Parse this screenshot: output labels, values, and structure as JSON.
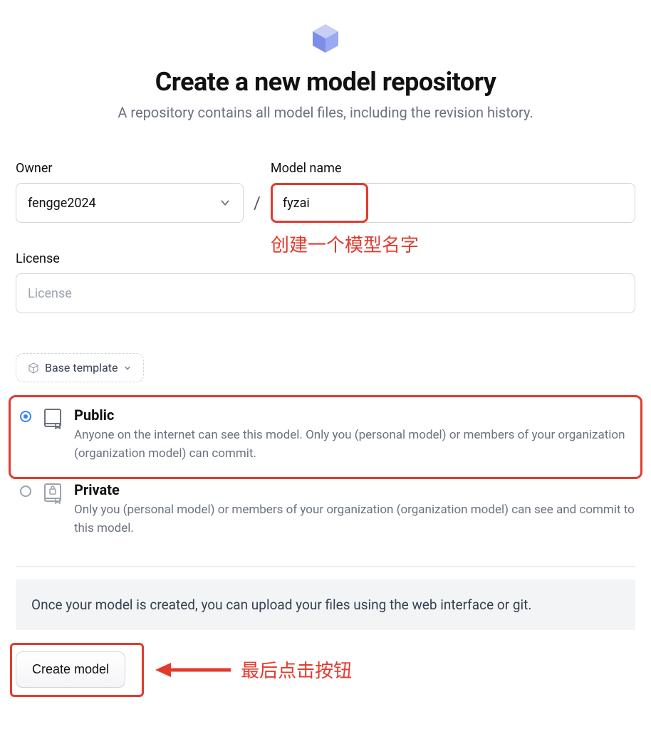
{
  "header": {
    "title": "Create a new model repository",
    "subtitle": "A repository contains all model files, including the revision history."
  },
  "fields": {
    "owner_label": "Owner",
    "owner_value": "fengge2024",
    "model_name_label": "Model name",
    "model_name_value": "fyzai",
    "license_label": "License",
    "license_placeholder": "License"
  },
  "template": {
    "label": "Base template"
  },
  "visibility": {
    "public": {
      "title": "Public",
      "desc": "Anyone on the internet can see this model. Only you (personal model) or members of your organization (organization model) can commit.",
      "selected": true
    },
    "private": {
      "title": "Private",
      "desc": "Only you (personal model) or members of your organization (organization model) can see and commit to this model.",
      "selected": false
    }
  },
  "info_banner": "Once your model is created, you can upload your files using the web interface or git.",
  "actions": {
    "create_label": "Create model"
  },
  "annotations": {
    "name_hint": "创建一个模型名字",
    "button_hint": "最后点击按钮"
  }
}
